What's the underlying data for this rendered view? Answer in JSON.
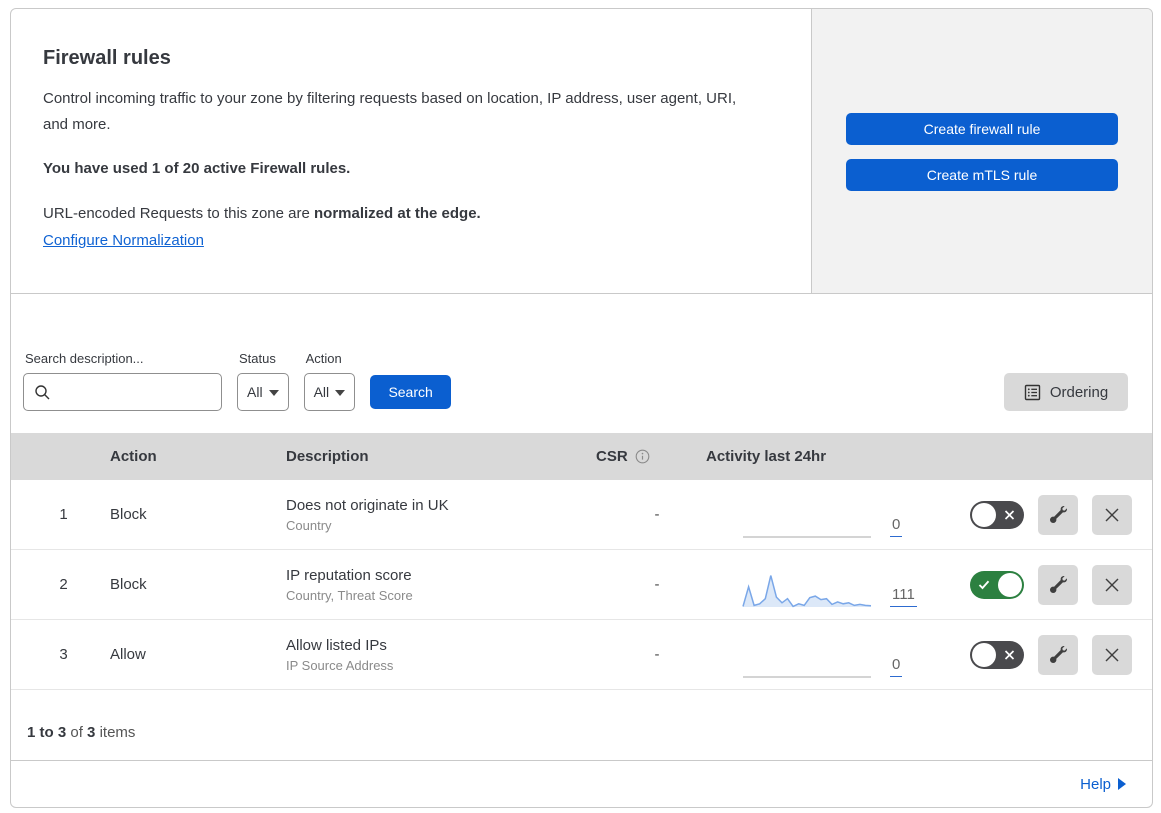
{
  "header": {
    "title": "Firewall rules",
    "description": "Control incoming traffic to your zone by filtering requests based on location, IP address, user agent, URI, and more.",
    "usage_note": "You have used 1 of 20 active Firewall rules.",
    "normalization_prefix": "URL-encoded Requests to this zone are ",
    "normalization_bold": "normalized at the edge.",
    "normalization_link": "Configure Normalization",
    "buttons": {
      "create_firewall": "Create firewall rule",
      "create_mtls": "Create mTLS rule"
    }
  },
  "filters": {
    "search_label": "Search description...",
    "status_label": "Status",
    "status_value": "All",
    "action_label": "Action",
    "action_value": "All",
    "search_button": "Search",
    "ordering_button": "Ordering"
  },
  "table": {
    "columns": {
      "action": "Action",
      "description": "Description",
      "csr": "CSR",
      "activity": "Activity last 24hr"
    },
    "rows": [
      {
        "priority": "1",
        "action": "Block",
        "description": "Does not originate in UK",
        "fields": "Country",
        "csr": "-",
        "activity_count": "0",
        "enabled": false,
        "sparkline": {
          "type": "flat"
        }
      },
      {
        "priority": "2",
        "action": "Block",
        "description": "IP reputation score",
        "fields": "Country, Threat Score",
        "csr": "-",
        "activity_count": "111",
        "enabled": true,
        "sparkline": {
          "type": "line",
          "values": [
            0.02,
            0.63,
            0.05,
            0.1,
            0.26,
            0.98,
            0.31,
            0.13,
            0.26,
            0.02,
            0.1,
            0.05,
            0.29,
            0.34,
            0.23,
            0.26,
            0.08,
            0.16,
            0.1,
            0.13,
            0.05,
            0.08,
            0.05,
            0.04
          ]
        }
      },
      {
        "priority": "3",
        "action": "Allow",
        "description": "Allow listed IPs",
        "fields": "IP Source Address",
        "csr": "-",
        "activity_count": "0",
        "enabled": false,
        "sparkline": {
          "type": "flat"
        }
      }
    ],
    "summary": {
      "range": "1 to 3",
      "of": "of",
      "total": "3",
      "items": "items"
    }
  },
  "footer": {
    "help": "Help"
  },
  "colors": {
    "accent_blue": "#0b5fd0",
    "link_blue": "#1063d3",
    "toggle_on_green": "#2c8040",
    "toggle_off_gray": "#4a4a4d",
    "panel_gray": "#f2f2f2",
    "table_header_gray": "#d9d9d9",
    "spark_line": "#7aa7e8",
    "spark_fill": "#dce8f8",
    "spark_flat": "#c6c6c6",
    "count_underline": "#2d6bd0"
  }
}
